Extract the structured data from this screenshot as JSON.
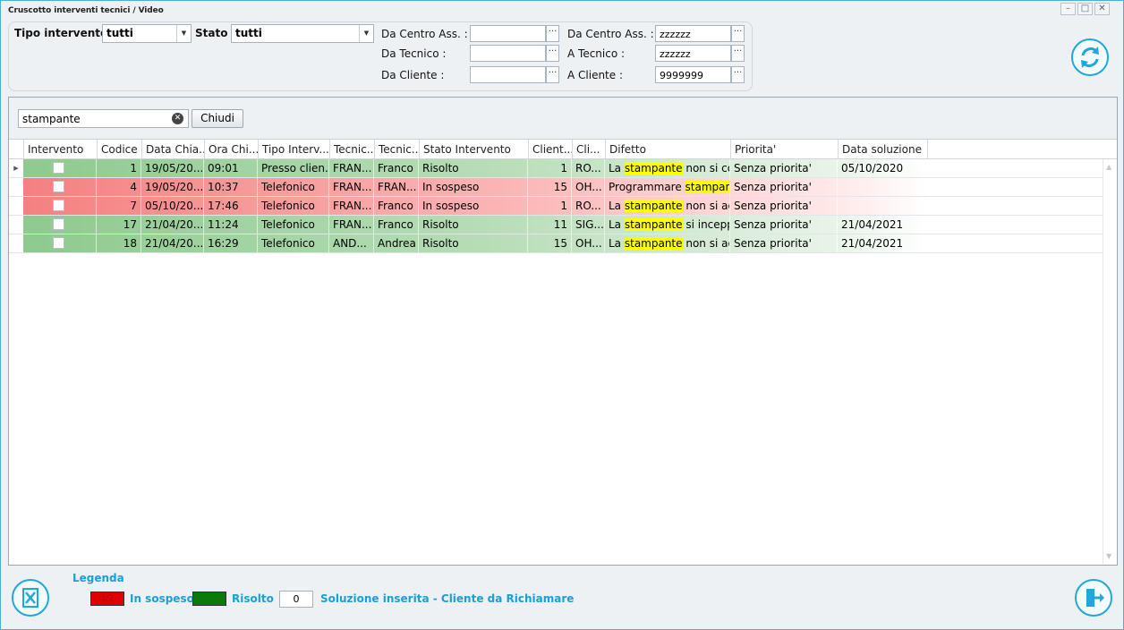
{
  "window": {
    "title": "Cruscotto interventi tecnici / Video"
  },
  "filters": {
    "tipo_label": "Tipo intervento :",
    "tipo_value": "tutti",
    "stato_label": "Stato :",
    "stato_value": "tutti",
    "da_centro_label": "Da Centro Ass. :",
    "da_centro_value": "",
    "a_centro_label": "Da Centro Ass. :",
    "a_centro_value": "zzzzzz",
    "da_tecnico_label": "Da Tecnico :",
    "da_tecnico_value": "",
    "a_tecnico_label": "A Tecnico :",
    "a_tecnico_value": "zzzzzz",
    "da_cliente_label": "Da Cliente :",
    "da_cliente_value": "",
    "a_cliente_label": "A Cliente :",
    "a_cliente_value": "9999999",
    "dots": "···"
  },
  "search": {
    "value": "stampante",
    "close_label": "Chiudi"
  },
  "grid": {
    "columns": [
      "Intervento",
      "Codice",
      "Data Chia...",
      "Ora Chi...",
      "Tipo Interv...",
      "Tecnic...",
      "Tecnic...",
      "Stato Intervento",
      "Client...",
      "Cli...",
      "Difetto",
      "Priorita'",
      "Data soluzione"
    ],
    "rows": [
      {
        "codice": "1",
        "data": "19/05/20...",
        "ora": "09:01",
        "tipo": "Presso clien...",
        "tec1": "FRAN...",
        "tec2": "Franco",
        "stato": "Risolto",
        "cliente": "1",
        "cli": "RO...",
        "dif_pre": "La ",
        "dif_hl": "stampante",
        "dif_post": " non si co...",
        "priorita": "Senza priorita'",
        "data_sol": "05/10/2020",
        "status": "risolto"
      },
      {
        "codice": "4",
        "data": "19/05/20...",
        "ora": "10:37",
        "tipo": "Telefonico",
        "tec1": "FRAN...",
        "tec2": "FRAN...",
        "stato": "In sospeso",
        "cliente": "15",
        "cli": "OH...",
        "dif_pre": "Programmare ",
        "dif_hl": "stampan...",
        "dif_post": "",
        "priorita": "Senza priorita'",
        "data_sol": "",
        "status": "sospeso"
      },
      {
        "codice": "7",
        "data": "05/10/20...",
        "ora": "17:46",
        "tipo": "Telefonico",
        "tec1": "FRAN...",
        "tec2": "Franco",
        "stato": "In sospeso",
        "cliente": "1",
        "cli": "RO...",
        "dif_pre": "La ",
        "dif_hl": "stampante",
        "dif_post": " non si ac...",
        "priorita": "Senza priorita'",
        "data_sol": "",
        "status": "sospeso"
      },
      {
        "codice": "17",
        "data": "21/04/20...",
        "ora": "11:24",
        "tipo": "Telefonico",
        "tec1": "FRAN...",
        "tec2": "Franco",
        "stato": "Risolto",
        "cliente": "11",
        "cli": "SIG...",
        "dif_pre": "La ",
        "dif_hl": "stampante",
        "dif_post": " si inceppa",
        "priorita": "Senza priorita'",
        "data_sol": "21/04/2021",
        "status": "risolto"
      },
      {
        "codice": "18",
        "data": "21/04/20...",
        "ora": "16:29",
        "tipo": "Telefonico",
        "tec1": "AND...",
        "tec2": "Andrea",
        "stato": "Risolto",
        "cliente": "15",
        "cli": "OH...",
        "dif_pre": "La ",
        "dif_hl": "stampante",
        "dif_post": " non si ac...",
        "priorita": "Senza priorita'",
        "data_sol": "21/04/2021",
        "status": "risolto"
      }
    ]
  },
  "legend": {
    "title": "Legenda",
    "sospeso_swatch": "1/2",
    "sospeso_label": "In sospeso",
    "risolto_swatch": "0",
    "risolto_label": "Risolto",
    "count": "0",
    "note": "Soluzione inserita - Cliente da Richiamare"
  },
  "colors": {
    "accent": "#20a7dc",
    "sospeso": "#f47f7f",
    "risolto": "#8dc98d"
  }
}
